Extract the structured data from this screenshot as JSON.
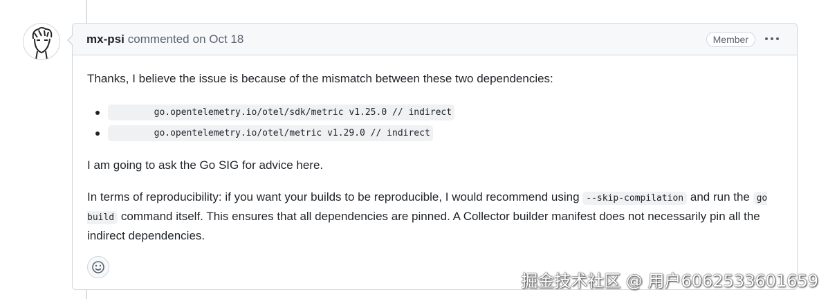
{
  "comment": {
    "author": "mx-psi",
    "action": "commented",
    "date": "on Oct 18",
    "badge": "Member",
    "menu_icon": "kebab-horizontal-icon",
    "body": {
      "intro": "Thanks, I believe the issue is because of the mismatch between these two dependencies:",
      "dependencies": [
        "        go.opentelemetry.io/otel/sdk/metric v1.25.0 // indirect",
        "        go.opentelemetry.io/otel/metric v1.29.0 // indirect"
      ],
      "go_sig": "I am going to ask the Go SIG for advice here.",
      "repro_part1": "In terms of reproducibility: if you want your builds to be reproducible, I would recommend using ",
      "repro_code1": "--skip-compilation",
      "repro_part2": " and run the ",
      "repro_code2": "go build",
      "repro_part3": " command itself. This ensures that all dependencies are pinned. A Collector builder manifest does not necessarily pin all the indirect dependencies."
    },
    "reaction_icon": "smiley-icon"
  },
  "watermark": "掘金技术社区 @ 用户6062533601659"
}
